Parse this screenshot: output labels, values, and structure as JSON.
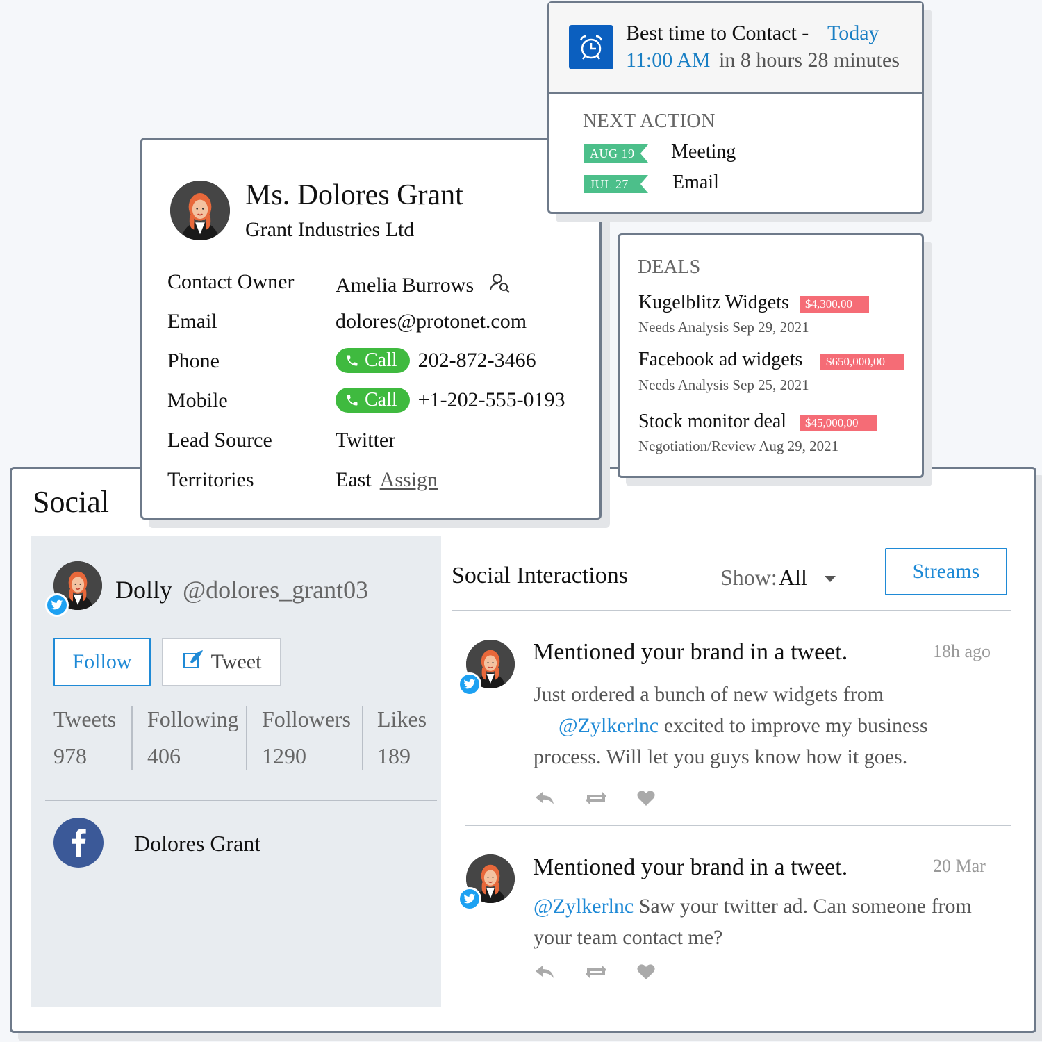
{
  "social": {
    "title": "Social",
    "profile": {
      "name": "Dolly",
      "handle": "@dolores_grant03"
    },
    "follow_label": "Follow",
    "tweet_label": "Tweet",
    "stats": [
      {
        "label": "Tweets",
        "value": "978"
      },
      {
        "label": "Following",
        "value": "406"
      },
      {
        "label": "Followers",
        "value": "1290"
      },
      {
        "label": "Likes",
        "value": "189"
      }
    ],
    "facebook_name": "Dolores Grant",
    "interactions_title": "Social Interactions",
    "show_label": "Show:",
    "show_value": "All",
    "streams_label": "Streams",
    "posts": [
      {
        "title": "Mentioned your brand in a tweet.",
        "time": "18h ago",
        "body_before": "Just ordered a bunch of new widgets from",
        "mention": "@Zylkerlnc",
        "body_after": "excited to improve my business process. Will let you guys know how it goes."
      },
      {
        "title": "Mentioned your brand in a tweet.",
        "time": "20 Mar",
        "mention": "@Zylkerlnc",
        "body_after": "Saw your twitter ad. Can someone from your team contact me?"
      }
    ]
  },
  "contact": {
    "name": "Ms. Dolores Grant",
    "company": "Grant Industries Ltd",
    "fields": {
      "owner_label": "Contact Owner",
      "owner_value": "Amelia Burrows",
      "email_label": "Email",
      "email_value": "dolores@protonet.com",
      "phone_label": "Phone",
      "phone_value": "202-872-3466",
      "mobile_label": "Mobile",
      "mobile_value": "+1-202-555-0193",
      "lead_label": "Lead Source",
      "lead_value": "Twitter",
      "territory_label": "Territories",
      "territory_value": "East",
      "assign_label": "Assign",
      "call_label": "Call"
    }
  },
  "best_time": {
    "line1": "Best time to Contact -",
    "day": "Today",
    "time": "11:00 AM",
    "relative": "in 8 hours 28 minutes"
  },
  "next_action": {
    "heading": "NEXT ACTION",
    "items": [
      {
        "date": "AUG 19",
        "label": "Meeting"
      },
      {
        "date": "JUL 27",
        "label": "Email"
      }
    ]
  },
  "deals": {
    "heading": "DEALS",
    "items": [
      {
        "name": "Kugelblitz Widgets",
        "amount": "$4,300.00",
        "meta": "Needs Analysis Sep 29, 2021"
      },
      {
        "name": "Facebook ad widgets",
        "amount": "$650,000,00",
        "meta": "Needs Analysis Sep 25, 2021"
      },
      {
        "name": "Stock monitor deal",
        "amount": "$45,000,00",
        "meta": "Negotiation/Review Aug 29, 2021"
      }
    ]
  },
  "colors": {
    "accent": "#1f8ad6",
    "call_green": "#3fba3f",
    "ribbon_green": "#4cbf8a",
    "deal_red": "#f56c76",
    "facebook": "#3b5998",
    "twitter": "#1da1f2"
  }
}
